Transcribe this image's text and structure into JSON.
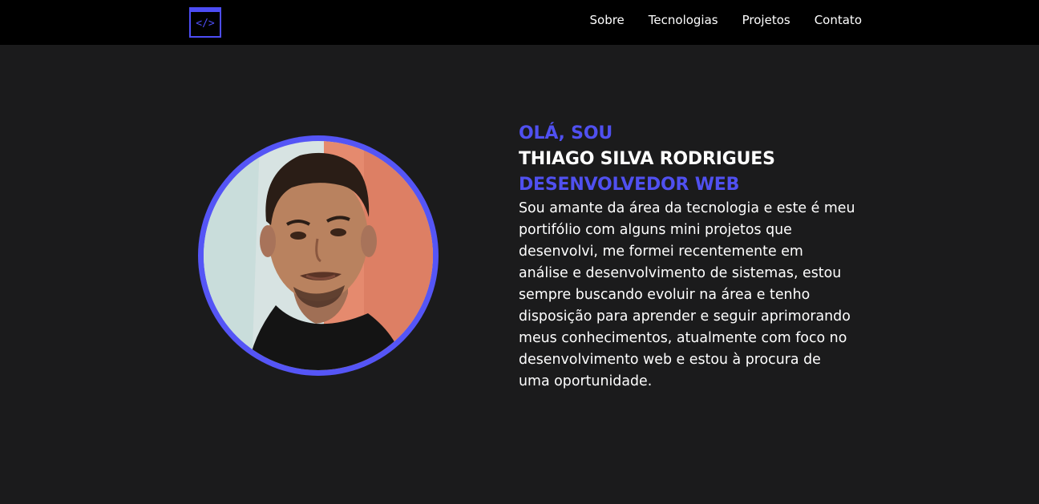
{
  "header": {
    "logo_icon": "code-brackets-icon",
    "logo_glyph": "</>",
    "nav": [
      {
        "label": "Sobre"
      },
      {
        "label": "Tecnologias"
      },
      {
        "label": "Projetos"
      },
      {
        "label": "Contato"
      }
    ]
  },
  "hero": {
    "greeting": "OLÁ, SOU",
    "name": "THIAGO SILVA RODRIGUES",
    "role": "DESENVOLVEDOR WEB",
    "bio": "Sou amante da área da tecnologia e este é meu portifólio com alguns mini projetos que desenvolvi, me formei recentemente em análise e desenvolvimento de sistemas, estou sempre buscando evoluir na área e tenho disposição para aprender e seguir aprimorando meus conhecimentos, atualmente com foco no desenvolvimento web e estou à procura de uma oportunidade."
  },
  "colors": {
    "accent": "#4d4df5",
    "background": "#1b1b1c",
    "header": "#000000",
    "text": "#ffffff"
  }
}
